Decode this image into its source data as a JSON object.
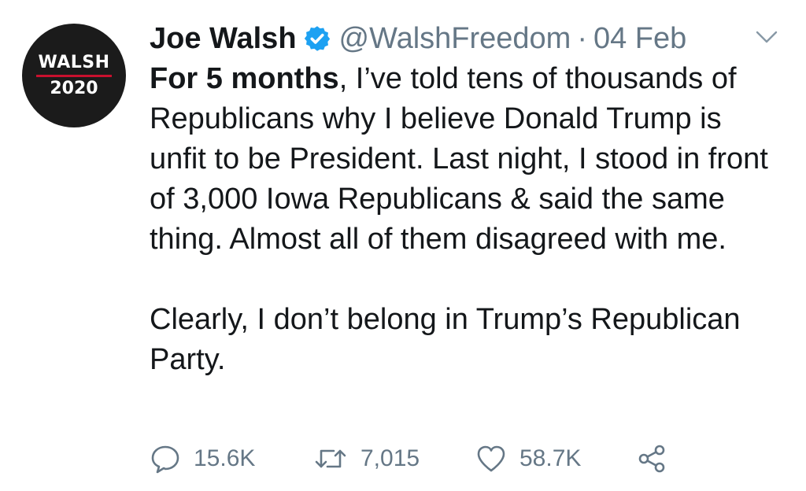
{
  "author": {
    "avatar_name": "WALSH",
    "avatar_year": "2020",
    "name": "Joe Walsh",
    "handle": "@WalshFreedom",
    "separator": "·",
    "date": "04 Feb"
  },
  "tweet": {
    "bold_lead": "For 5 months",
    "text_1": ", I’ve told tens of thousands of Republicans why I believe Donald Trump is unfit to be President. Last night, I stood in front of 3,000 Iowa Republicans & said the same thing. Almost all of them disagreed with me.",
    "text_2": "Clearly, I don’t belong in Trump’s Republican Party."
  },
  "actions": {
    "replies": "15.6K",
    "retweets": "7,015",
    "likes": "58.7K"
  },
  "icons": {
    "verified": "verified-badge-icon",
    "menu": "chevron-down-icon",
    "reply": "reply-bubble-icon",
    "retweet": "retweet-icon",
    "like": "heart-icon",
    "share": "share-icon"
  },
  "colors": {
    "verified_blue": "#1da1f2",
    "secondary_text": "#657786",
    "primary_text": "#14171a",
    "avatar_bg": "#1b1b1b",
    "avatar_accent": "#c8102e"
  }
}
